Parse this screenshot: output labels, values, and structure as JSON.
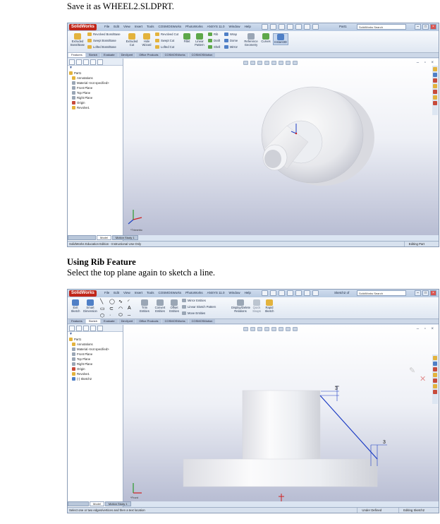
{
  "doc": {
    "save_text": "Save it as WHEEL2.SLDPRT.",
    "heading": "Using Rib Feature",
    "instruction": "Select the top plane again to sketch a line."
  },
  "window1": {
    "app_name": "SolidWorks",
    "menus": [
      "File",
      "Edit",
      "View",
      "Insert",
      "Tools",
      "COSMOSWorks",
      "PhotoWorks",
      "ANSYS 11.0",
      "Window",
      "Help"
    ],
    "doc_title": "Part1",
    "search_placeholder": "SolidWorks Search",
    "commands": {
      "extruded_boss": "Extruded Boss/Base",
      "revolved_boss": "Revolved Boss/Base",
      "swept_boss": "Swept Boss/Base",
      "lofted_boss": "Lofted Boss/Base",
      "extruded_cut": "Extruded Cut",
      "hole_wizard": "Hole Wizard",
      "revolved_cut": "Revolved Cut",
      "swept_cut": "Swept Cut",
      "lofted_cut": "Lofted Cut",
      "fillet": "Fillet",
      "linear_pattern": "Linear Pattern",
      "rib": "Rib",
      "draft": "Draft",
      "shell": "Shell",
      "wrap": "Wrap",
      "dome": "Dome",
      "mirror": "Mirror",
      "reference_geometry": "Reference Geometry",
      "curves": "Curves",
      "instant3d": "Instant3D"
    },
    "tabs": [
      "Features",
      "Sketch",
      "Evaluate",
      "DimXpert",
      "Office Products",
      "COSMOSWorks",
      "COSMOSMotion"
    ],
    "tree": [
      "Part1",
      "Annotations",
      "Material <not specified>",
      "Front Plane",
      "Top Plane",
      "Right Plane",
      "Origin",
      "Revolve1"
    ],
    "bottom_tabs": [
      "Model",
      "Motion Study 1"
    ],
    "view_label": "*Trimetric",
    "status_left": "SolidWorks Education Edition - Instructional Use Only",
    "status_right": [
      "Editing Part"
    ]
  },
  "window2": {
    "app_name": "SolidWorks",
    "menus": [
      "File",
      "Edit",
      "View",
      "Insert",
      "Tools",
      "COSMOSWorks",
      "PhotoWorks",
      "ANSYS 11.0",
      "Window",
      "Help"
    ],
    "doc_title": "Sketch2 of",
    "search_placeholder": "SolidWorks Search",
    "commands": {
      "exit_sketch": "Exit Sketch",
      "smart_dimension": "Smart Dimension",
      "trim_entities": "Trim Entities",
      "convert_entities": "Convert Entities",
      "offset_entities": "Offset Entities",
      "mirror_entities": "Mirror Entities",
      "linear_sketch_pattern": "Linear Sketch Pattern",
      "move_entities": "Move Entities",
      "display_relations": "Display/Delete Relations",
      "quick_snaps": "Quick Snaps",
      "rapid_sketch": "Rapid Sketch"
    },
    "tabs": [
      "Features",
      "Sketch",
      "Evaluate",
      "DimXpert",
      "Office Products",
      "COSMOSWorks",
      "COSMOSMotion"
    ],
    "tree": [
      "Part1",
      "Annotations",
      "Material <not specified>",
      "Front Plane",
      "Top Plane",
      "Right Plane",
      "Origin",
      "Revolve1",
      "(-) Sketch2"
    ],
    "bottom_tabs": [
      "Model",
      "Motion Study 1"
    ],
    "view_label": "*Front",
    "dimension_1": "3",
    "dimension_2": "3",
    "status_left": "Select one or two edges/vertices and then a text location",
    "status_right": [
      "Under Defined",
      "Editing Sketch2"
    ]
  },
  "colors": {
    "title_blue": "#b9cbe3",
    "sketch_line": "#1c3cc4",
    "origin_red": "#d02020",
    "logo_red": "#c0261a"
  }
}
